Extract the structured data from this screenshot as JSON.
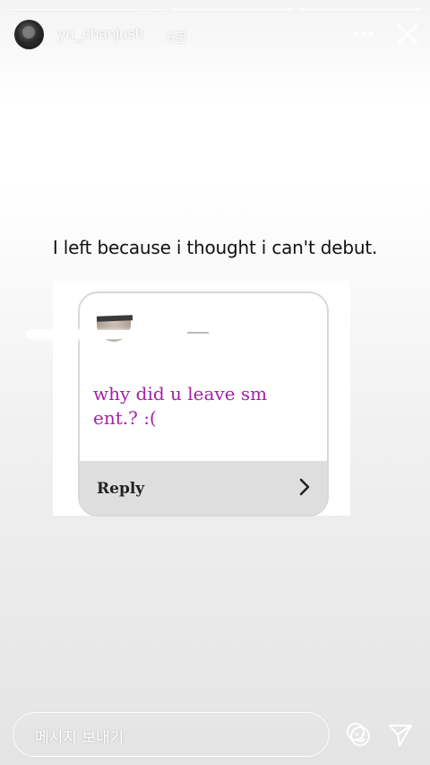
{
  "story": {
    "segments": [
      {
        "filled": true
      },
      {
        "filled": false
      },
      {
        "filled": false
      },
      {
        "filled": false
      }
    ],
    "active_segment_index": 1
  },
  "header": {
    "username": "yu_chanjush",
    "time": "6분",
    "more_icon": "more-horizontal-icon",
    "close_icon": "close-icon"
  },
  "caption": "I left because i thought i can't debut.",
  "embedded_card": {
    "question": "why did u leave sm ent.? :(",
    "reply_label": "Reply",
    "reply_icon": "chevron-right-icon"
  },
  "footer": {
    "message_placeholder": "메시지 보내기",
    "reaction_icon": "reaction-emoji-icon",
    "send_icon": "send-icon"
  }
}
